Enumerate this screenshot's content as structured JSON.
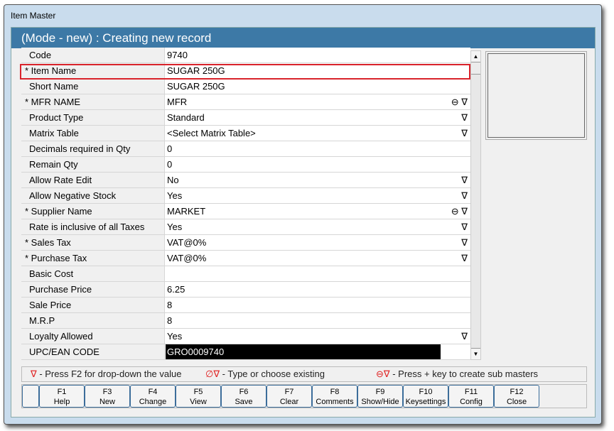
{
  "window": {
    "title": "Item Master",
    "header": "(Mode - new) : Creating new record"
  },
  "rows": [
    {
      "label": "Code",
      "value": "9740",
      "req": false,
      "icons": ""
    },
    {
      "label": "* Item Name",
      "value": "SUGAR 250G",
      "req": true,
      "icons": ""
    },
    {
      "label": "Short Name",
      "value": "SUGAR 250G",
      "req": false,
      "icons": ""
    },
    {
      "label": "* MFR NAME",
      "value": "MFR",
      "req": true,
      "icons": "⊖ ∇"
    },
    {
      "label": "Product Type",
      "value": "Standard",
      "req": false,
      "icons": "∇"
    },
    {
      "label": "Matrix Table",
      "value": "<Select Matrix Table>",
      "req": false,
      "icons": "∇"
    },
    {
      "label": "Decimals required in Qty",
      "value": "0",
      "req": false,
      "icons": ""
    },
    {
      "label": "Remain Qty",
      "value": "0",
      "req": false,
      "icons": ""
    },
    {
      "label": "Allow Rate Edit",
      "value": "No",
      "req": false,
      "icons": "∇"
    },
    {
      "label": "Allow Negative Stock",
      "value": "Yes",
      "req": false,
      "icons": "∇"
    },
    {
      "label": "* Supplier Name",
      "value": "MARKET",
      "req": true,
      "icons": "⊖ ∇"
    },
    {
      "label": "Rate is inclusive of all Taxes",
      "value": "Yes",
      "req": false,
      "icons": "∇"
    },
    {
      "label": "* Sales Tax",
      "value": "VAT@0%",
      "req": true,
      "icons": "∇"
    },
    {
      "label": "* Purchase Tax",
      "value": "VAT@0%",
      "req": true,
      "icons": "∇"
    },
    {
      "label": "Basic Cost",
      "value": "",
      "req": false,
      "icons": ""
    },
    {
      "label": "Purchase Price",
      "value": "6.25",
      "req": false,
      "icons": ""
    },
    {
      "label": "Sale Price",
      "value": "8",
      "req": false,
      "icons": ""
    },
    {
      "label": "M.R.P",
      "value": "8",
      "req": false,
      "icons": ""
    },
    {
      "label": "Loyalty Allowed",
      "value": "Yes",
      "req": false,
      "icons": "∇"
    },
    {
      "label": "UPC/EAN CODE",
      "value": "GRO0009740",
      "req": false,
      "icons": "",
      "black": true
    }
  ],
  "legend": [
    {
      "icon": "∇",
      "text": " - Press F2 for drop-down the value"
    },
    {
      "icon": "∅∇",
      "text": " - Type or choose existing"
    },
    {
      "icon": "⊖∇",
      "text": " - Press + key to create sub masters"
    }
  ],
  "buttons": [
    {
      "key": "F1",
      "label": "Help"
    },
    {
      "key": "F3",
      "label": "New"
    },
    {
      "key": "F4",
      "label": "Change"
    },
    {
      "key": "F5",
      "label": "View"
    },
    {
      "key": "F6",
      "label": "Save"
    },
    {
      "key": "F7",
      "label": "Clear"
    },
    {
      "key": "F8",
      "label": "Comments"
    },
    {
      "key": "F9",
      "label": "Show/Hide"
    },
    {
      "key": "F10",
      "label": "Keysettings"
    },
    {
      "key": "F11",
      "label": "Config"
    },
    {
      "key": "F12",
      "label": "Close"
    }
  ]
}
